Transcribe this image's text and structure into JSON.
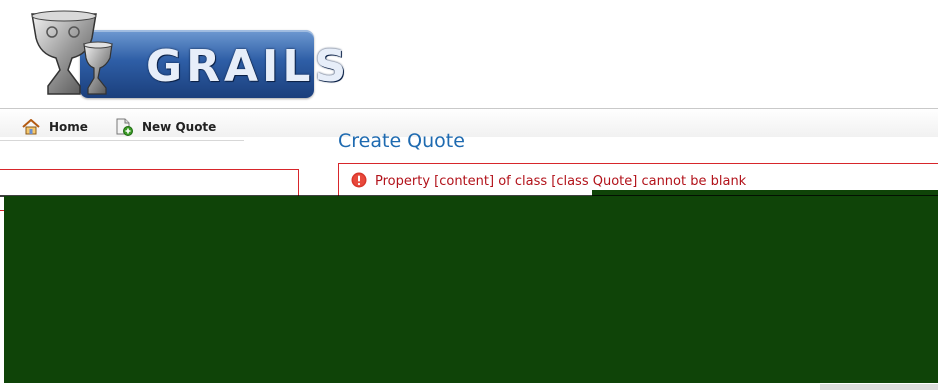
{
  "logo": {
    "text": "GRAILS"
  },
  "nav": {
    "home": {
      "label": "Home",
      "icon": "home-icon"
    },
    "new_quote": {
      "label": "New Quote",
      "icon": "new-document-icon"
    }
  },
  "main": {
    "title": "Create Quote",
    "errors": [
      {
        "icon": "error-icon",
        "message": "Property [content] of class [class Quote] cannot be blank"
      }
    ]
  },
  "colors": {
    "title": "#1e6ab0",
    "error_text": "#b2121a",
    "error_border": "#d7262b",
    "overlay": "#0f4408",
    "logo_blue": "#2e5ea6"
  }
}
